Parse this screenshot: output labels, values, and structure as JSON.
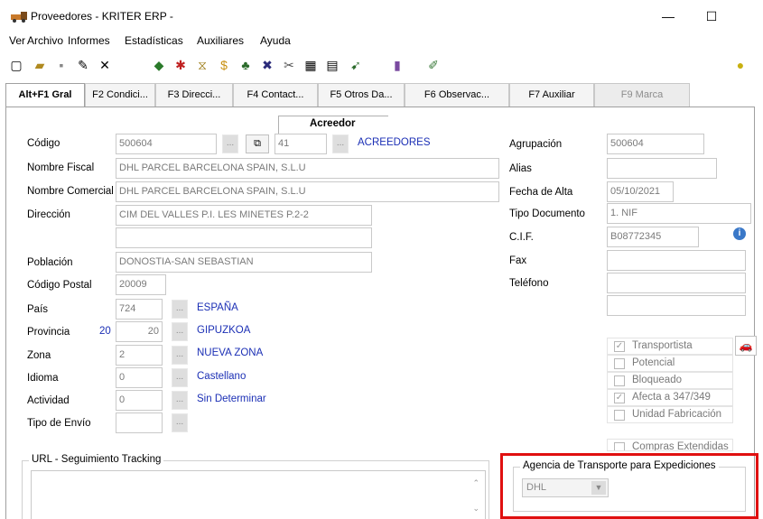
{
  "window": {
    "title": "Proveedores - KRITER ERP -",
    "minimize": "—",
    "maximize": "☐"
  },
  "menu": [
    {
      "label": "Ver"
    },
    {
      "label": "Archivo"
    },
    {
      "label": "Informes"
    },
    {
      "label": "Estadísticas"
    },
    {
      "label": "Auxiliares"
    },
    {
      "label": "Ayuda"
    }
  ],
  "tabs": [
    {
      "label": "Alt+F1 Gral"
    },
    {
      "label": "F2 Condici..."
    },
    {
      "label": "F3 Direcci..."
    },
    {
      "label": "F4 Contact..."
    },
    {
      "label": "F5 Otros Da..."
    },
    {
      "label": "F6 Observac..."
    },
    {
      "label": "F7 Auxiliar"
    },
    {
      "label": "F9 Marca"
    }
  ],
  "form": {
    "acreedor_title": "Acreedor",
    "codigo": {
      "label": "Código",
      "value": "500604",
      "acreedor_code": "41",
      "acreedor_name": "ACREEDORES"
    },
    "nombre_fiscal": {
      "label": "Nombre Fiscal",
      "value": "DHL PARCEL BARCELONA SPAIN, S.L.U"
    },
    "nombre_comercial": {
      "label": "Nombre Comercial",
      "value": "DHL PARCEL BARCELONA SPAIN, S.L.U"
    },
    "direccion": {
      "label": "Dirección",
      "value": "CIM DEL VALLES P.I. LES MINETES P.2-2",
      "value2": ""
    },
    "poblacion": {
      "label": "Población",
      "value": "DONOSTIA-SAN SEBASTIAN"
    },
    "codigo_postal": {
      "label": "Código Postal",
      "value": "20009"
    },
    "pais": {
      "label": "País",
      "value": "724",
      "name": "ESPAÑA"
    },
    "provincia": {
      "label": "Provincia",
      "code": "20",
      "value": "20",
      "name": "GIPUZKOA"
    },
    "zona": {
      "label": "Zona",
      "value": "2",
      "name": "NUEVA ZONA"
    },
    "idioma": {
      "label": "Idioma",
      "value": "0",
      "name": "Castellano"
    },
    "actividad": {
      "label": "Actividad",
      "value": "0",
      "name": "Sin Determinar"
    },
    "tipo_envio": {
      "label": "Tipo de Envío",
      "value": ""
    },
    "agrupacion": {
      "label": "Agrupación",
      "value": "500604"
    },
    "alias": {
      "label": "Alias",
      "value": ""
    },
    "fecha_alta": {
      "label": "Fecha de Alta",
      "value": "05/10/2021"
    },
    "tipo_documento": {
      "label": "Tipo Documento",
      "value": "1. NIF"
    },
    "cif": {
      "label": "C.I.F.",
      "value": "B08772345"
    },
    "fax": {
      "label": "Fax",
      "value": ""
    },
    "telefono": {
      "label": "Teléfono",
      "value": "",
      "value2": ""
    }
  },
  "checks": [
    {
      "label": "Transportista",
      "checked": true
    },
    {
      "label": "Potencial",
      "checked": false
    },
    {
      "label": "Bloqueado",
      "checked": false
    },
    {
      "label": "Afecta a 347/349",
      "checked": true
    },
    {
      "label": "Unidad Fabricación",
      "checked": false
    },
    {
      "label": "Compras Extendidas",
      "checked": false
    }
  ],
  "tracking": {
    "title": "URL - Seguimiento Tracking",
    "value": ""
  },
  "agencia": {
    "title": "Agencia de Transporte para Expediciones",
    "value": "DHL"
  },
  "colors": {
    "accent_blue": "#1b2fb5",
    "highlight_red": "#e01010"
  }
}
